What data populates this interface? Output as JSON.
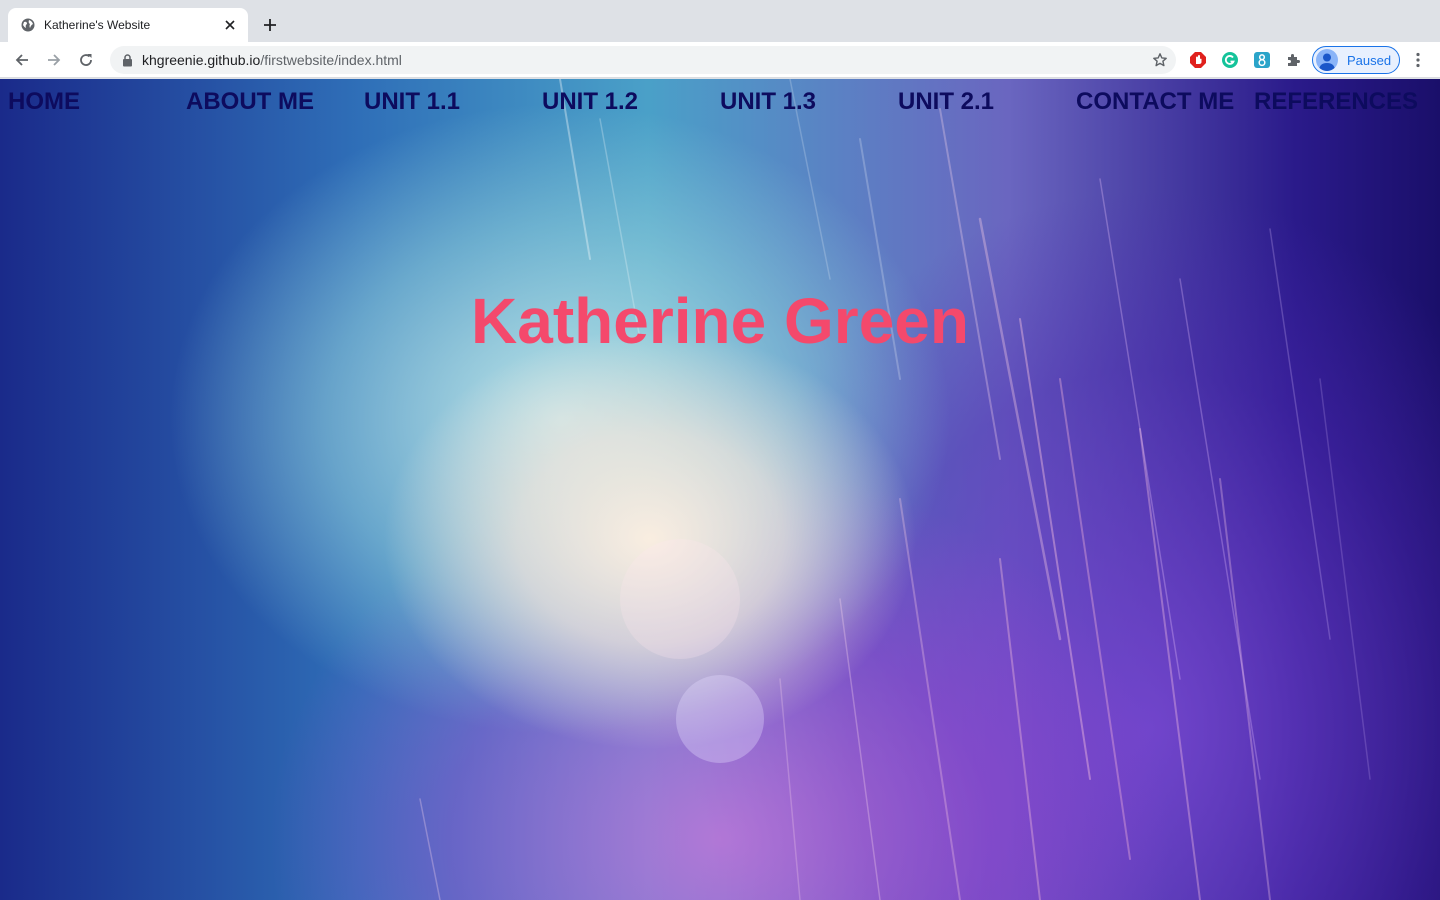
{
  "browser": {
    "tab": {
      "title": "Katherine's Website"
    },
    "omnibox": {
      "host": "khgreenie.github.io",
      "path": "/firstwebsite/index.html"
    },
    "profile": {
      "label": "Paused"
    },
    "extensions": [
      "adblock-icon",
      "grammarly-icon",
      "extension-8-icon",
      "puzzle-icon"
    ]
  },
  "site": {
    "nav": [
      {
        "label": "HOME"
      },
      {
        "label": "ABOUT ME"
      },
      {
        "label": "UNIT 1.1"
      },
      {
        "label": "UNIT 1.2"
      },
      {
        "label": "UNIT 1.3"
      },
      {
        "label": "UNIT 2.1"
      },
      {
        "label": "CONTACT ME"
      },
      {
        "label": "REFERENCES"
      }
    ],
    "hero_title": "Katherine Green"
  },
  "colors": {
    "nav_text": "#0d0b5e",
    "hero_title": "#f4496c",
    "profile_accent": "#1a73e8"
  }
}
